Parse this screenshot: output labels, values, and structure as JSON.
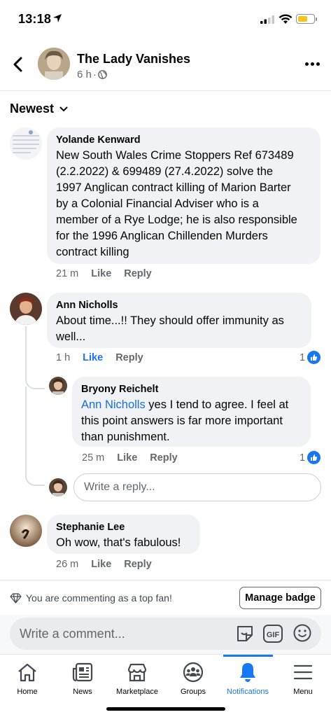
{
  "status_bar": {
    "time": "13:18"
  },
  "header": {
    "title": "The Lady Vanishes",
    "age": "6 h",
    "separator": "·"
  },
  "sort": {
    "label": "Newest"
  },
  "comments": [
    {
      "name": "Yolande Kenward",
      "text_lines": [
        "New South Wales Crime Stoppers Ref 673489",
        "(2.2.2022) & 699489 (27.4.2022) solve the",
        "1997 Anglican contract killing of Marion Barter",
        "by a Colonial Financial Adviser who is a",
        "member of a Rye Lodge; he is also responsible",
        "for the 1996 Anglican Chillenden Murders",
        "contract killing"
      ],
      "time": "21 m",
      "like": "Like",
      "reply": "Reply"
    },
    {
      "name": "Ann Nicholls",
      "text_lines": [
        "About time...!! They should offer immunity as",
        "well..."
      ],
      "time": "1 h",
      "like": "Like",
      "reply": "Reply",
      "reactions": "1"
    },
    {
      "name": "Stephanie Lee",
      "text_lines": [
        "Oh wow, that's fabulous!"
      ],
      "time": "26 m",
      "like": "Like",
      "reply": "Reply"
    }
  ],
  "reply": {
    "name": "Bryony Reichelt",
    "mention": "Ann Nicholls",
    "text_first": " yes I tend to agree. I feel at",
    "text_lines": [
      "this point answers is far more important",
      "than punishment."
    ],
    "time": "25 m",
    "like": "Like",
    "reply": "Reply",
    "reactions": "1"
  },
  "reply_input": {
    "placeholder": "Write a reply..."
  },
  "fan": {
    "text": "You are commenting as a top fan!",
    "button": "Manage badge"
  },
  "composer": {
    "placeholder": "Write a comment...",
    "gif_label": "GIF"
  },
  "nav": {
    "items": [
      {
        "label": "Home",
        "icon": "home-icon"
      },
      {
        "label": "News",
        "icon": "news-icon"
      },
      {
        "label": "Marketplace",
        "icon": "marketplace-icon"
      },
      {
        "label": "Groups",
        "icon": "groups-icon"
      },
      {
        "label": "Notifications",
        "icon": "bell-icon"
      },
      {
        "label": "Menu",
        "icon": "menu-icon"
      }
    ],
    "active": "Notifications"
  },
  "colors": {
    "accent": "#1877f2",
    "bubble": "#f0f2f5",
    "muted": "#65676b"
  }
}
